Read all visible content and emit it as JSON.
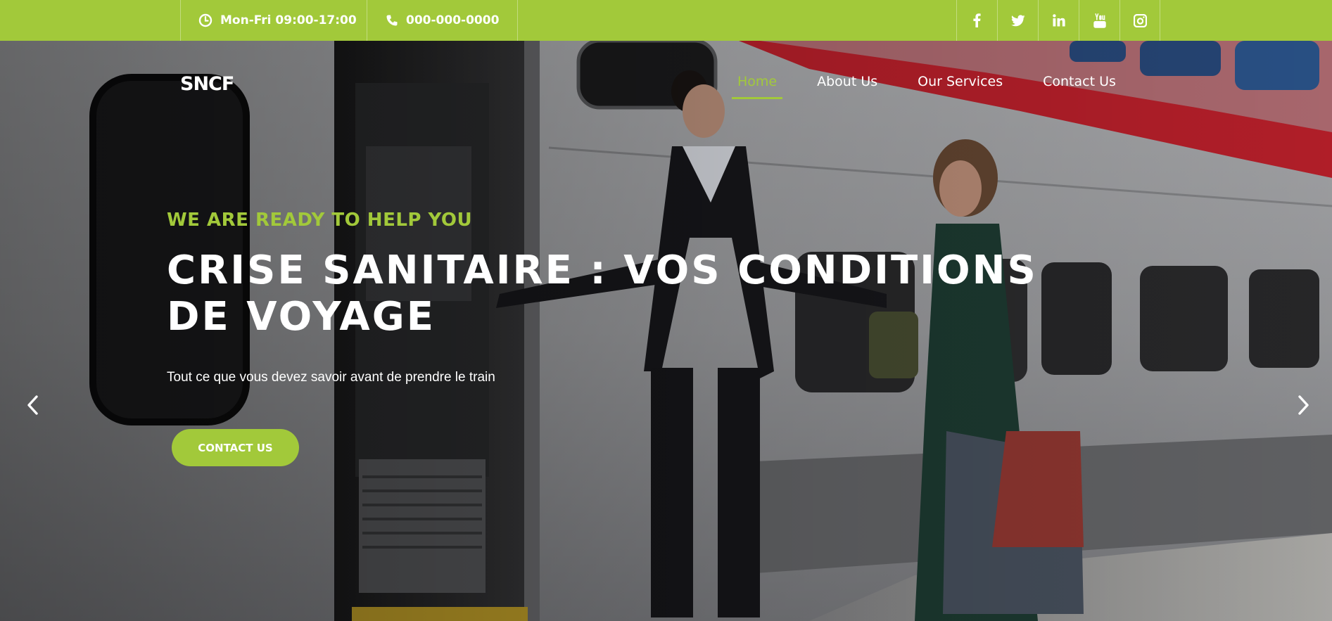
{
  "topbar": {
    "hours": "Mon-Fri 09:00-17:00",
    "phone": "000-000-0000",
    "socials": [
      {
        "icon": "facebook-icon"
      },
      {
        "icon": "twitter-icon"
      },
      {
        "icon": "linkedin-icon"
      },
      {
        "icon": "youtube-icon"
      },
      {
        "icon": "instagram-icon"
      }
    ]
  },
  "header": {
    "logo": "SNCF",
    "nav": [
      {
        "label": "Home",
        "active": true
      },
      {
        "label": "About Us",
        "active": false
      },
      {
        "label": "Our Services",
        "active": false
      },
      {
        "label": "Contact Us",
        "active": false
      }
    ]
  },
  "hero": {
    "eyebrow": "WE ARE READY TO HELP YOU",
    "title": "CRISE SANITAIRE : VOS CONDITIONS DE VOYAGE",
    "subtitle": "Tout ce que vous devez savoir avant de prendre le train",
    "cta_label": "CONTACT US",
    "prev_icon": "chevron-left-icon",
    "next_icon": "chevron-right-icon"
  },
  "colors": {
    "accent": "#a2c93a",
    "train_stripe": "#d8202e",
    "text_light": "#ffffff"
  }
}
